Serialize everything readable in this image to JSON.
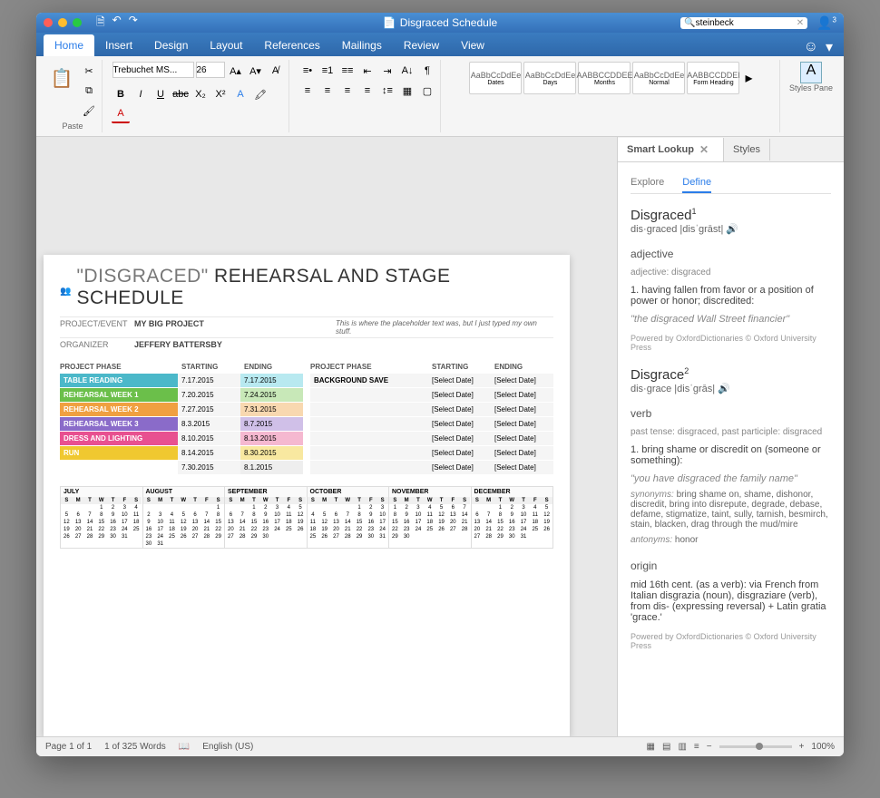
{
  "titlebar": {
    "doc_name": "Disgraced Schedule",
    "search_value": "steinbeck",
    "user_badge": "3"
  },
  "tabs": [
    "Home",
    "Insert",
    "Design",
    "Layout",
    "References",
    "Mailings",
    "Review",
    "View"
  ],
  "ribbon": {
    "paste_label": "Paste",
    "font_name": "Trebuchet MS...",
    "font_size": "26",
    "styles": [
      {
        "sample": "AaBbCcDdEe",
        "name": "Dates"
      },
      {
        "sample": "AaBbCcDdEe",
        "name": "Days"
      },
      {
        "sample": "AABBCCDDEE",
        "name": "Months"
      },
      {
        "sample": "AaBbCcDdEe",
        "name": "Normal"
      },
      {
        "sample": "AABBCCDDEI",
        "name": "Form Heading"
      }
    ],
    "styles_pane": "Styles Pane"
  },
  "document": {
    "heading_pre": "\"DISGRACED\"",
    "heading_post": " REHEARSAL AND STAGE SCHEDULE",
    "meta": [
      {
        "label": "PROJECT/EVENT",
        "value": "MY BIG PROJECT",
        "desc": "This is where the placeholder text was, but I just typed my own stuff."
      },
      {
        "label": "ORGANIZER",
        "value": "JEFFERY BATTERSBY",
        "desc": ""
      }
    ],
    "phase_headers": {
      "c1": "PROJECT PHASE",
      "c2": "STARTING",
      "c3": "ENDING"
    },
    "phases_left": [
      {
        "name": "TABLE READING",
        "start": "7.17.2015",
        "end": "7.17.2015",
        "color": "#4bb8c9",
        "ecolor": "#b8e9f0"
      },
      {
        "name": "REHEARSAL WEEK 1",
        "start": "7.20.2015",
        "end": "7.24.2015",
        "color": "#6bbf4a",
        "ecolor": "#c8e8b8"
      },
      {
        "name": "REHEARSAL WEEK 2",
        "start": "7.27.2015",
        "end": "7.31.2015",
        "color": "#f0a040",
        "ecolor": "#f8d8b0"
      },
      {
        "name": "REHEARSAL WEEK 3",
        "start": "8.3.2015",
        "end": "8.7.2015",
        "color": "#8a6bc9",
        "ecolor": "#d0c0e8"
      },
      {
        "name": "DRESS AND LIGHTING",
        "start": "8.10.2015",
        "end": "8.13.2015",
        "color": "#e85090",
        "ecolor": "#f5b8d0"
      },
      {
        "name": "RUN",
        "start": "8.14.2015",
        "end": "8.30.2015",
        "color": "#f0c830",
        "ecolor": "#f8e8a0"
      },
      {
        "name": "",
        "start": "7.30.2015",
        "end": "8.1.2015",
        "color": "transparent",
        "ecolor": "#eee"
      }
    ],
    "phases_right": [
      {
        "name": "BACKGROUND SAVE",
        "start": "[Select Date]",
        "end": "[Select Date]"
      },
      {
        "name": "",
        "start": "[Select Date]",
        "end": "[Select Date]"
      },
      {
        "name": "",
        "start": "[Select Date]",
        "end": "[Select Date]"
      },
      {
        "name": "",
        "start": "[Select Date]",
        "end": "[Select Date]"
      },
      {
        "name": "",
        "start": "[Select Date]",
        "end": "[Select Date]"
      },
      {
        "name": "",
        "start": "[Select Date]",
        "end": "[Select Date]"
      },
      {
        "name": "",
        "start": "[Select Date]",
        "end": "[Select Date]"
      }
    ],
    "calendar_months": [
      "JULY",
      "AUGUST",
      "SEPTEMBER",
      "OCTOBER",
      "NOVEMBER",
      "DECEMBER"
    ],
    "calendar_dayheaders": [
      "S",
      "M",
      "T",
      "W",
      "T",
      "F",
      "S"
    ],
    "calendar_days": {
      "JULY": [
        "",
        "",
        "",
        "1",
        "2",
        "3",
        "4",
        "5",
        "6",
        "7",
        "8",
        "9",
        "10",
        "11",
        "12",
        "13",
        "14",
        "15",
        "16",
        "17",
        "18",
        "19",
        "20",
        "21",
        "22",
        "23",
        "24",
        "25",
        "26",
        "27",
        "28",
        "29",
        "30",
        "31"
      ],
      "AUGUST": [
        "",
        "",
        "",
        "",
        "",
        "",
        "1",
        "2",
        "3",
        "4",
        "5",
        "6",
        "7",
        "8",
        "9",
        "10",
        "11",
        "12",
        "13",
        "14",
        "15",
        "16",
        "17",
        "18",
        "19",
        "20",
        "21",
        "22",
        "23",
        "24",
        "25",
        "26",
        "27",
        "28",
        "29",
        "30",
        "31"
      ],
      "SEPTEMBER": [
        "",
        "",
        "1",
        "2",
        "3",
        "4",
        "5",
        "6",
        "7",
        "8",
        "9",
        "10",
        "11",
        "12",
        "13",
        "14",
        "15",
        "16",
        "17",
        "18",
        "19",
        "20",
        "21",
        "22",
        "23",
        "24",
        "25",
        "26",
        "27",
        "28",
        "29",
        "30"
      ],
      "OCTOBER": [
        "",
        "",
        "",
        "",
        "1",
        "2",
        "3",
        "4",
        "5",
        "6",
        "7",
        "8",
        "9",
        "10",
        "11",
        "12",
        "13",
        "14",
        "15",
        "16",
        "17",
        "18",
        "19",
        "20",
        "21",
        "22",
        "23",
        "24",
        "25",
        "26",
        "27",
        "28",
        "29",
        "30",
        "31"
      ],
      "NOVEMBER": [
        "1",
        "2",
        "3",
        "4",
        "5",
        "6",
        "7",
        "8",
        "9",
        "10",
        "11",
        "12",
        "13",
        "14",
        "15",
        "16",
        "17",
        "18",
        "19",
        "20",
        "21",
        "22",
        "23",
        "24",
        "25",
        "26",
        "27",
        "28",
        "29",
        "30"
      ],
      "DECEMBER": [
        "",
        "",
        "1",
        "2",
        "3",
        "4",
        "5",
        "6",
        "7",
        "8",
        "9",
        "10",
        "11",
        "12",
        "13",
        "14",
        "15",
        "16",
        "17",
        "18",
        "19",
        "20",
        "21",
        "22",
        "23",
        "24",
        "25",
        "26",
        "27",
        "28",
        "29",
        "30",
        "31"
      ]
    }
  },
  "side": {
    "tab1": "Smart Lookup",
    "tab2": "Styles",
    "sub_explore": "Explore",
    "sub_define": "Define",
    "entries": [
      {
        "word": "Disgraced",
        "sup": "1",
        "pron": "dis·graced |disˈɡrāst|",
        "pos": "adjective",
        "sub": "adjective: disgraced",
        "def": "1. having fallen from favor or a position of power or honor; discredited:",
        "ex": "\"the disgraced Wall Street financier\"",
        "credit": "Powered by OxfordDictionaries © Oxford University Press"
      },
      {
        "word": "Disgrace",
        "sup": "2",
        "pron": "dis·grace |disˈɡrās|",
        "pos": "verb",
        "sub": "past tense: disgraced, past participle: disgraced",
        "def": "1. bring shame or discredit on (someone or something):",
        "ex": "\"you have disgraced the family name\"",
        "syn": "synonyms: bring shame on, shame, dishonor, discredit, bring into disrepute, degrade, debase, defame, stigmatize, taint, sully, tarnish, besmirch, stain, blacken, drag through the mud/mire",
        "ant": "antonyms: honor",
        "origin_h": "origin",
        "origin": "mid 16th cent. (as a verb): via French from Italian disgrazia (noun), disgraziare (verb), from dis- (expressing reversal) + Latin gratia 'grace.'",
        "credit": "Powered by OxfordDictionaries © Oxford University Press"
      }
    ]
  },
  "status": {
    "page": "Page 1 of 1",
    "words": "1 of 325 Words",
    "lang": "English (US)",
    "zoom": "100%"
  }
}
